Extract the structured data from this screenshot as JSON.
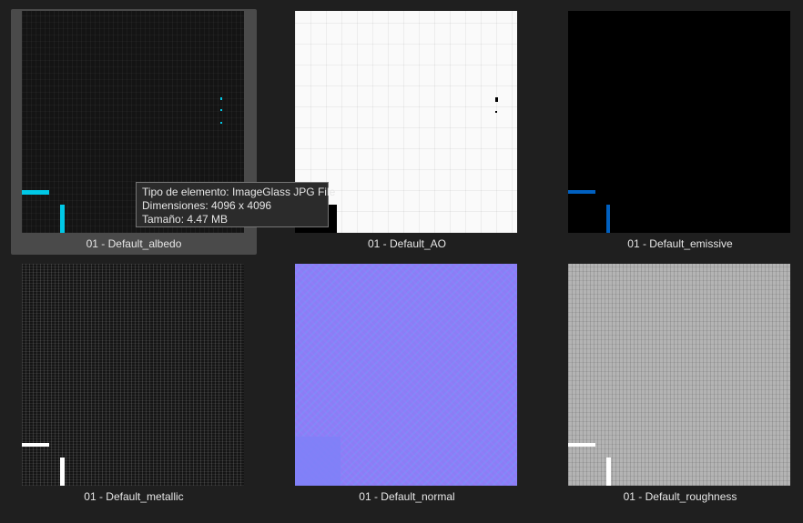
{
  "items": [
    {
      "label": "01 - Default_albedo",
      "selected": true
    },
    {
      "label": "01 - Default_AO",
      "selected": false
    },
    {
      "label": "01 - Default_emissive",
      "selected": false
    },
    {
      "label": "01 - Default_metallic",
      "selected": false
    },
    {
      "label": "01 - Default_normal",
      "selected": false
    },
    {
      "label": "01 - Default_roughness",
      "selected": false
    }
  ],
  "tooltip": {
    "type_line": "Tipo de elemento: ImageGlass JPG File",
    "dimensions_line": "Dimensiones: 4096 x 4096",
    "size_line": "Tamaño: 4.47 MB"
  },
  "colors": {
    "background": "#1f1f1f",
    "selection": "#4a4a4a",
    "albedo_accent": "#00c8e6",
    "emissive_accent": "#0060c0"
  }
}
